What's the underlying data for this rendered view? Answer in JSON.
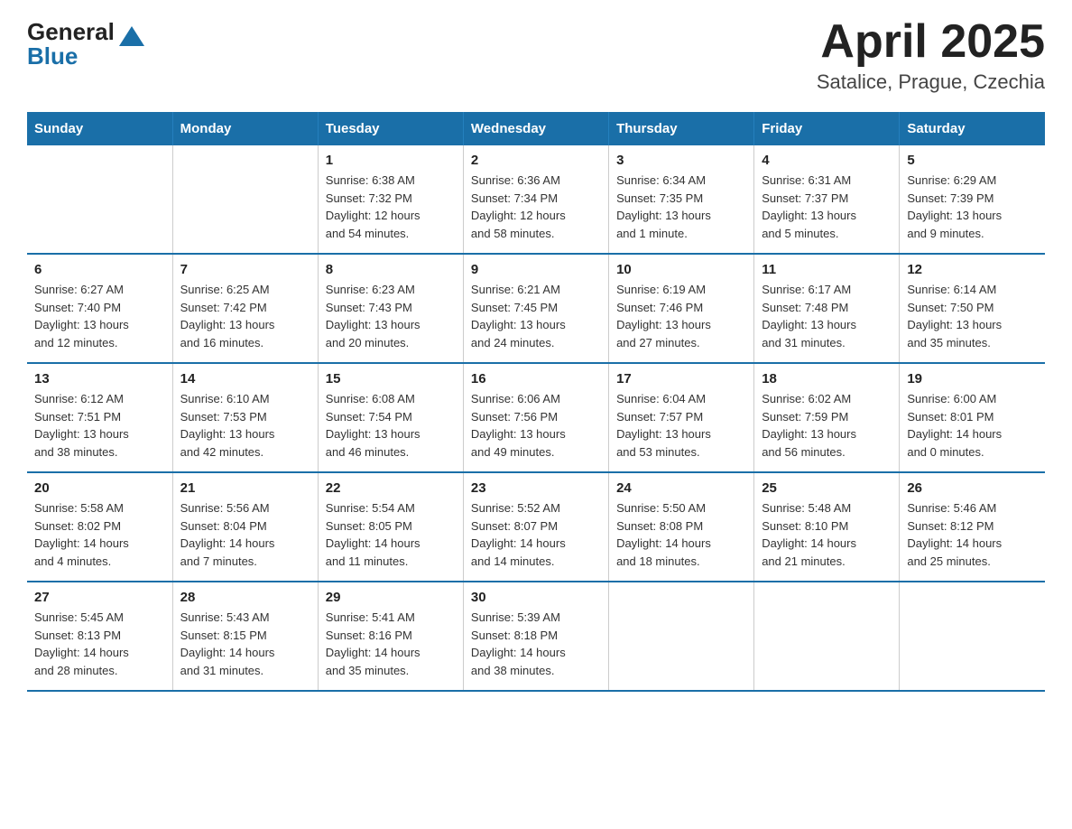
{
  "header": {
    "logo_general": "General",
    "logo_blue": "Blue",
    "title": "April 2025",
    "subtitle": "Satalice, Prague, Czechia"
  },
  "weekdays": [
    "Sunday",
    "Monday",
    "Tuesday",
    "Wednesday",
    "Thursday",
    "Friday",
    "Saturday"
  ],
  "weeks": [
    [
      {
        "day": "",
        "info": ""
      },
      {
        "day": "",
        "info": ""
      },
      {
        "day": "1",
        "info": "Sunrise: 6:38 AM\nSunset: 7:32 PM\nDaylight: 12 hours\nand 54 minutes."
      },
      {
        "day": "2",
        "info": "Sunrise: 6:36 AM\nSunset: 7:34 PM\nDaylight: 12 hours\nand 58 minutes."
      },
      {
        "day": "3",
        "info": "Sunrise: 6:34 AM\nSunset: 7:35 PM\nDaylight: 13 hours\nand 1 minute."
      },
      {
        "day": "4",
        "info": "Sunrise: 6:31 AM\nSunset: 7:37 PM\nDaylight: 13 hours\nand 5 minutes."
      },
      {
        "day": "5",
        "info": "Sunrise: 6:29 AM\nSunset: 7:39 PM\nDaylight: 13 hours\nand 9 minutes."
      }
    ],
    [
      {
        "day": "6",
        "info": "Sunrise: 6:27 AM\nSunset: 7:40 PM\nDaylight: 13 hours\nand 12 minutes."
      },
      {
        "day": "7",
        "info": "Sunrise: 6:25 AM\nSunset: 7:42 PM\nDaylight: 13 hours\nand 16 minutes."
      },
      {
        "day": "8",
        "info": "Sunrise: 6:23 AM\nSunset: 7:43 PM\nDaylight: 13 hours\nand 20 minutes."
      },
      {
        "day": "9",
        "info": "Sunrise: 6:21 AM\nSunset: 7:45 PM\nDaylight: 13 hours\nand 24 minutes."
      },
      {
        "day": "10",
        "info": "Sunrise: 6:19 AM\nSunset: 7:46 PM\nDaylight: 13 hours\nand 27 minutes."
      },
      {
        "day": "11",
        "info": "Sunrise: 6:17 AM\nSunset: 7:48 PM\nDaylight: 13 hours\nand 31 minutes."
      },
      {
        "day": "12",
        "info": "Sunrise: 6:14 AM\nSunset: 7:50 PM\nDaylight: 13 hours\nand 35 minutes."
      }
    ],
    [
      {
        "day": "13",
        "info": "Sunrise: 6:12 AM\nSunset: 7:51 PM\nDaylight: 13 hours\nand 38 minutes."
      },
      {
        "day": "14",
        "info": "Sunrise: 6:10 AM\nSunset: 7:53 PM\nDaylight: 13 hours\nand 42 minutes."
      },
      {
        "day": "15",
        "info": "Sunrise: 6:08 AM\nSunset: 7:54 PM\nDaylight: 13 hours\nand 46 minutes."
      },
      {
        "day": "16",
        "info": "Sunrise: 6:06 AM\nSunset: 7:56 PM\nDaylight: 13 hours\nand 49 minutes."
      },
      {
        "day": "17",
        "info": "Sunrise: 6:04 AM\nSunset: 7:57 PM\nDaylight: 13 hours\nand 53 minutes."
      },
      {
        "day": "18",
        "info": "Sunrise: 6:02 AM\nSunset: 7:59 PM\nDaylight: 13 hours\nand 56 minutes."
      },
      {
        "day": "19",
        "info": "Sunrise: 6:00 AM\nSunset: 8:01 PM\nDaylight: 14 hours\nand 0 minutes."
      }
    ],
    [
      {
        "day": "20",
        "info": "Sunrise: 5:58 AM\nSunset: 8:02 PM\nDaylight: 14 hours\nand 4 minutes."
      },
      {
        "day": "21",
        "info": "Sunrise: 5:56 AM\nSunset: 8:04 PM\nDaylight: 14 hours\nand 7 minutes."
      },
      {
        "day": "22",
        "info": "Sunrise: 5:54 AM\nSunset: 8:05 PM\nDaylight: 14 hours\nand 11 minutes."
      },
      {
        "day": "23",
        "info": "Sunrise: 5:52 AM\nSunset: 8:07 PM\nDaylight: 14 hours\nand 14 minutes."
      },
      {
        "day": "24",
        "info": "Sunrise: 5:50 AM\nSunset: 8:08 PM\nDaylight: 14 hours\nand 18 minutes."
      },
      {
        "day": "25",
        "info": "Sunrise: 5:48 AM\nSunset: 8:10 PM\nDaylight: 14 hours\nand 21 minutes."
      },
      {
        "day": "26",
        "info": "Sunrise: 5:46 AM\nSunset: 8:12 PM\nDaylight: 14 hours\nand 25 minutes."
      }
    ],
    [
      {
        "day": "27",
        "info": "Sunrise: 5:45 AM\nSunset: 8:13 PM\nDaylight: 14 hours\nand 28 minutes."
      },
      {
        "day": "28",
        "info": "Sunrise: 5:43 AM\nSunset: 8:15 PM\nDaylight: 14 hours\nand 31 minutes."
      },
      {
        "day": "29",
        "info": "Sunrise: 5:41 AM\nSunset: 8:16 PM\nDaylight: 14 hours\nand 35 minutes."
      },
      {
        "day": "30",
        "info": "Sunrise: 5:39 AM\nSunset: 8:18 PM\nDaylight: 14 hours\nand 38 minutes."
      },
      {
        "day": "",
        "info": ""
      },
      {
        "day": "",
        "info": ""
      },
      {
        "day": "",
        "info": ""
      }
    ]
  ]
}
